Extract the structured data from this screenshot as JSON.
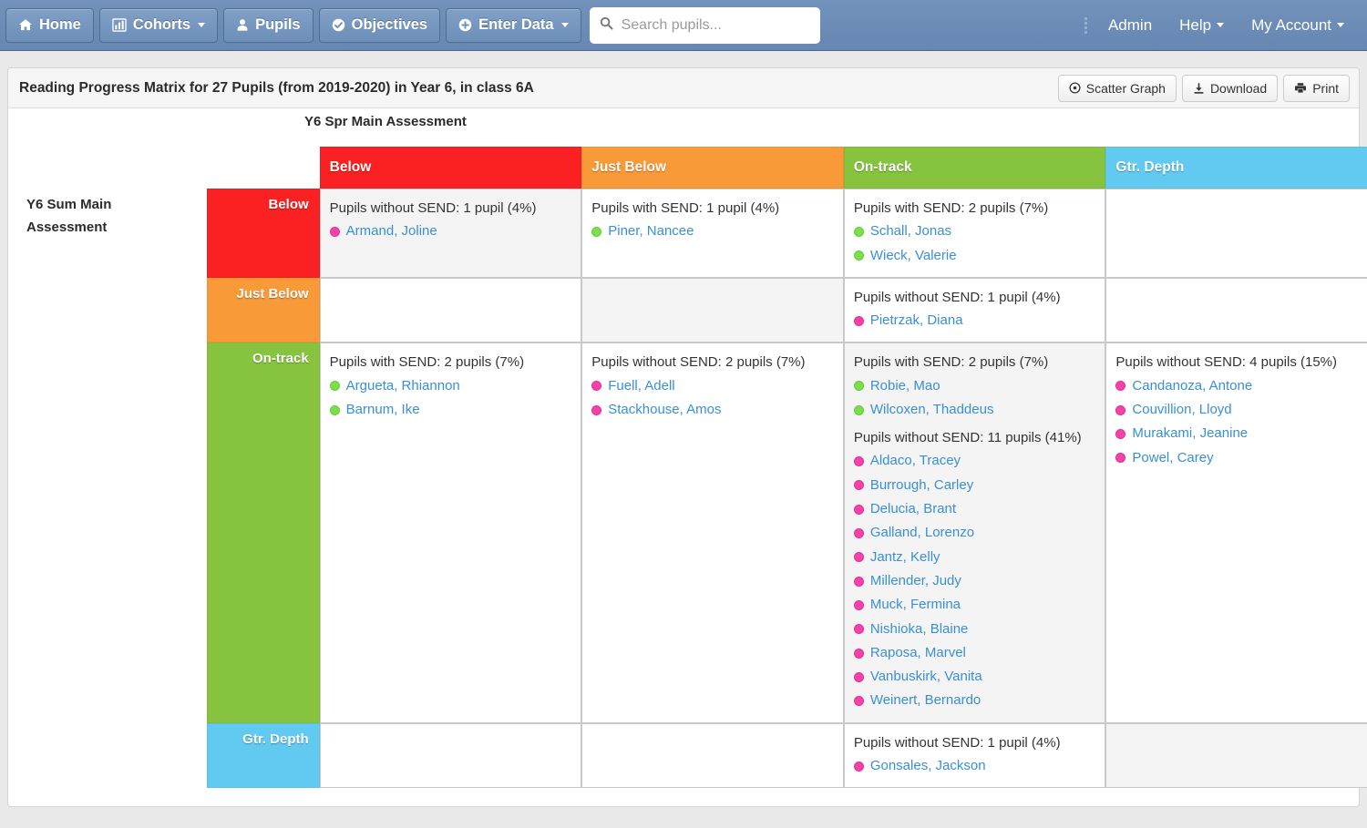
{
  "navbar": {
    "buttons": [
      {
        "label": "Home",
        "icon": "home-icon",
        "caret": false
      },
      {
        "label": "Cohorts",
        "icon": "chart-bar-icon",
        "caret": true
      },
      {
        "label": "Pupils",
        "icon": "user-icon",
        "caret": false
      },
      {
        "label": "Objectives",
        "icon": "check-circle-icon",
        "caret": false
      },
      {
        "label": "Enter Data",
        "icon": "plus-circle-icon",
        "caret": true
      }
    ],
    "search": {
      "placeholder": "Search pupils...",
      "value": "",
      "icon": "search-icon"
    },
    "grip_icon": "drag-handle-icon",
    "links": [
      {
        "label": "Admin",
        "caret": false
      },
      {
        "label": "Help",
        "caret": true
      },
      {
        "label": "My Account",
        "caret": true
      }
    ]
  },
  "panel": {
    "title": "Reading Progress Matrix for 27 Pupils (from 2019-2020) in Year 6, in class 6A",
    "actions": [
      {
        "label": "Scatter Graph",
        "icon": "target-icon"
      },
      {
        "label": "Download",
        "icon": "download-icon"
      },
      {
        "label": "Print",
        "icon": "printer-icon"
      }
    ]
  },
  "matrix": {
    "x_axis_label": "Y6 Spr Main Assessment",
    "y_axis_label": "Y6 Sum Main Assessment",
    "band_colors": {
      "Below": "#fb2021",
      "Just Below": "#f89a38",
      "On-track": "#86c440",
      "Gtr. Depth": "#62caf0"
    },
    "columns": [
      "Below",
      "Just Below",
      "On-track",
      "Gtr. Depth"
    ],
    "rows": [
      {
        "label": "Below",
        "cells": [
          {
            "diagonal": true,
            "groups": [
              {
                "heading": "Pupils without SEND: 1 pupil (4%)",
                "send": false,
                "pupils": [
                  "Armand, Joline"
                ]
              }
            ]
          },
          {
            "diagonal": false,
            "groups": [
              {
                "heading": "Pupils with SEND: 1 pupil (4%)",
                "send": true,
                "pupils": [
                  "Piner, Nancee"
                ]
              }
            ]
          },
          {
            "diagonal": false,
            "groups": [
              {
                "heading": "Pupils with SEND: 2 pupils (7%)",
                "send": true,
                "pupils": [
                  "Schall, Jonas",
                  "Wieck, Valerie"
                ]
              }
            ]
          },
          {
            "diagonal": false,
            "groups": []
          }
        ]
      },
      {
        "label": "Just Below",
        "cells": [
          {
            "diagonal": false,
            "groups": []
          },
          {
            "diagonal": true,
            "groups": []
          },
          {
            "diagonal": false,
            "groups": [
              {
                "heading": "Pupils without SEND: 1 pupil (4%)",
                "send": false,
                "pupils": [
                  "Pietrzak, Diana"
                ]
              }
            ]
          },
          {
            "diagonal": false,
            "groups": []
          }
        ]
      },
      {
        "label": "On-track",
        "cells": [
          {
            "diagonal": false,
            "groups": [
              {
                "heading": "Pupils with SEND: 2 pupils (7%)",
                "send": true,
                "pupils": [
                  "Argueta, Rhiannon",
                  "Barnum, Ike"
                ]
              }
            ]
          },
          {
            "diagonal": false,
            "groups": [
              {
                "heading": "Pupils without SEND: 2 pupils (7%)",
                "send": false,
                "pupils": [
                  "Fuell, Adell",
                  "Stackhouse, Amos"
                ]
              }
            ]
          },
          {
            "diagonal": true,
            "groups": [
              {
                "heading": "Pupils with SEND: 2 pupils (7%)",
                "send": true,
                "pupils": [
                  "Robie, Mao",
                  "Wilcoxen, Thaddeus"
                ]
              },
              {
                "heading": "Pupils without SEND: 11 pupils (41%)",
                "send": false,
                "pupils": [
                  "Aldaco, Tracey",
                  "Burrough, Carley",
                  "Delucia, Brant",
                  "Galland, Lorenzo",
                  "Jantz, Kelly",
                  "Millender, Judy",
                  "Muck, Fermina",
                  "Nishioka, Blaine",
                  "Raposa, Marvel",
                  "Vanbuskirk, Vanita",
                  "Weinert, Bernardo"
                ]
              }
            ]
          },
          {
            "diagonal": false,
            "groups": [
              {
                "heading": "Pupils without SEND: 4 pupils (15%)",
                "send": false,
                "pupils": [
                  "Candanoza, Antone",
                  "Couvillion, Lloyd",
                  "Murakami, Jeanine",
                  "Powel, Carey"
                ]
              }
            ]
          }
        ]
      },
      {
        "label": "Gtr. Depth",
        "cells": [
          {
            "diagonal": false,
            "groups": []
          },
          {
            "diagonal": false,
            "groups": []
          },
          {
            "diagonal": false,
            "groups": [
              {
                "heading": "Pupils without SEND: 1 pupil (4%)",
                "send": false,
                "pupils": [
                  "Gonsales, Jackson"
                ]
              }
            ]
          },
          {
            "diagonal": true,
            "groups": []
          }
        ]
      }
    ]
  }
}
